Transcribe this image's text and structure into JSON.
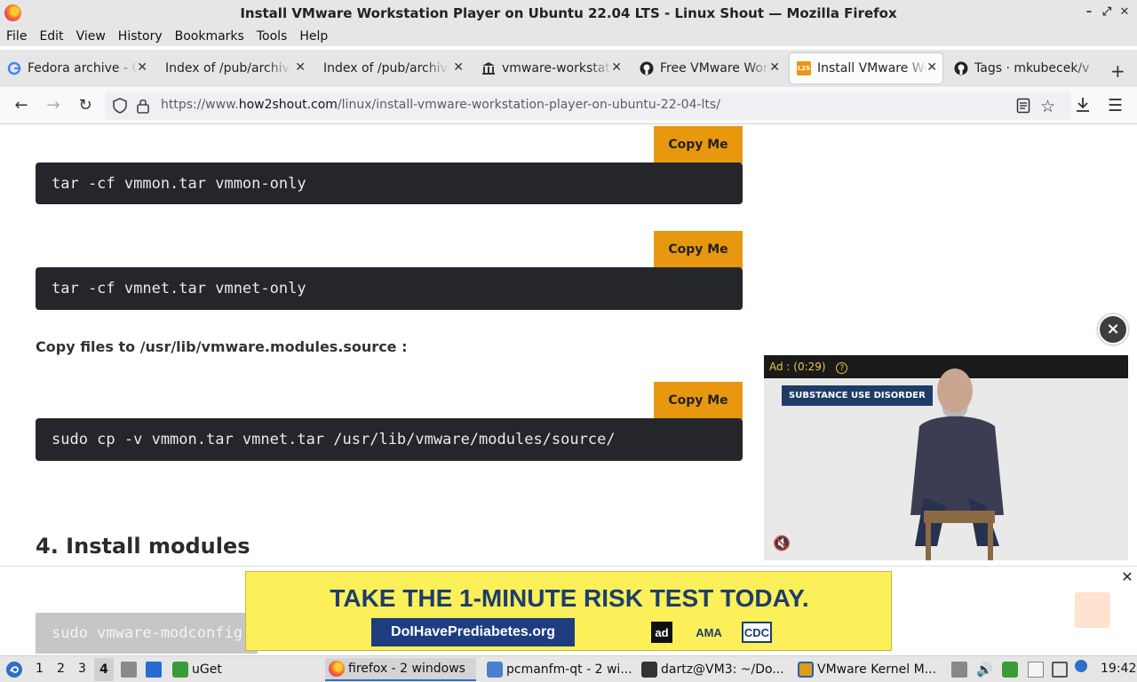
{
  "window": {
    "title": "Install VMware Workstation Player on Ubuntu 22.04 LTS - Linux Shout — Mozilla Firefox"
  },
  "menu": [
    "File",
    "Edit",
    "View",
    "History",
    "Bookmarks",
    "Tools",
    "Help"
  ],
  "tabs": [
    {
      "label": "Fedora archive - G",
      "icon": "google-icon"
    },
    {
      "label": "Index of /pub/archive",
      "icon": "none"
    },
    {
      "label": "Index of /pub/archive",
      "icon": "none"
    },
    {
      "label": "vmware-workstatio",
      "icon": "bank-icon"
    },
    {
      "label": "Free VMware Work",
      "icon": "github-icon"
    },
    {
      "label": "Install VMware Wo",
      "icon": "l2s-icon",
      "icon_text": "L2S",
      "active": true
    },
    {
      "label": "Tags · mkubecek/v",
      "icon": "github-icon"
    }
  ],
  "nav": {
    "url_prefix": "https://www.",
    "url_domain": "how2shout.com",
    "url_path": "/linux/install-vmware-workstation-player-on-ubuntu-22-04-lts/"
  },
  "content": {
    "copy_label": "Copy Me",
    "code1": "tar -cf vmmon.tar vmmon-only",
    "code2": "tar -cf vmnet.tar vmnet-only",
    "para": "Copy files to /usr/lib/vmware.modules.source :",
    "code3": "sudo cp -v vmmon.tar vmnet.tar /usr/lib/vmware/modules/source/",
    "heading": "4. Install modules",
    "code4": "sudo vmware-modconfig"
  },
  "video_ad": {
    "label": "Ad : (0:29)",
    "badge": "SUBSTANCE USE DISORDER",
    "close": "×"
  },
  "banner": {
    "headline": "TAKE THE 1-MINUTE RISK TEST TODAY.",
    "url": "DoIHavePrediabetes.org",
    "logos": [
      "ad",
      "AMA",
      "CDC"
    ],
    "close": "✕"
  },
  "taskbar": {
    "workspaces": [
      "1",
      "2",
      "3",
      "4"
    ],
    "active_workspace": "4",
    "tasks": [
      {
        "label": "uGet"
      },
      {
        "label": "firefox - 2 windows"
      },
      {
        "label": "pcmanfm-qt - 2 wi..."
      },
      {
        "label": "dartz@VM3: ~/Do..."
      },
      {
        "label": "VMware Kernel M..."
      }
    ],
    "clock": "19:42"
  },
  "colors": {
    "copy_button": "#e8980f",
    "code_bg": "#24262b",
    "banner_bg": "#fbef5a",
    "banner_text": "#1d3d6b"
  }
}
